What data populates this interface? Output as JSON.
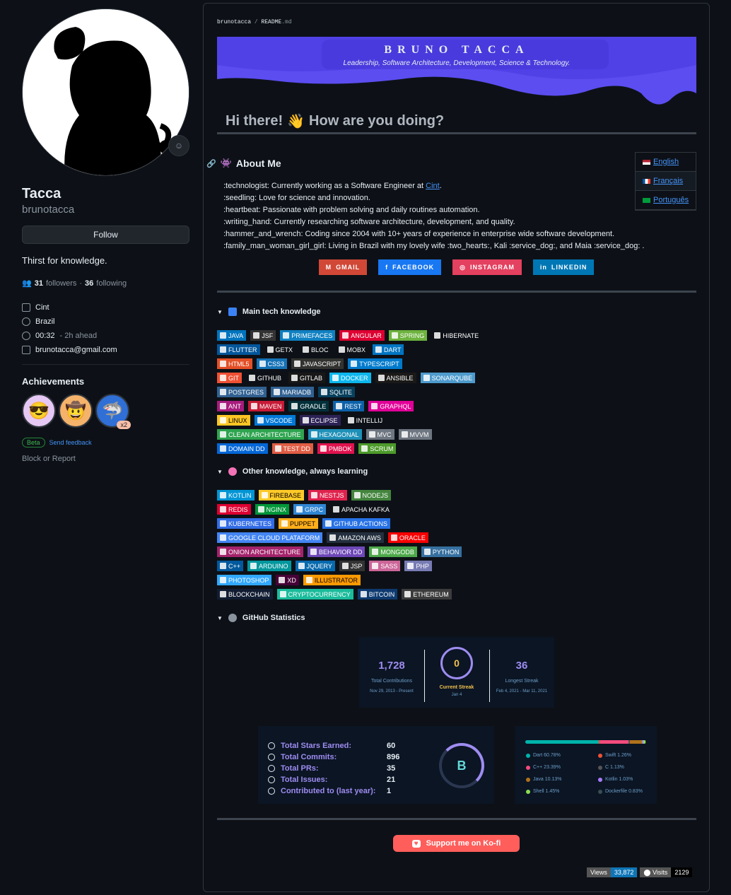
{
  "sidebar": {
    "name": "Tacca",
    "login": "brunotacca",
    "follow_label": "Follow",
    "bio": "Thirst for knowledge.",
    "followers_count": "31",
    "followers_label": "followers",
    "following_count": "36",
    "following_label": "following",
    "info": [
      {
        "icon": "building-icon",
        "text": "Cint"
      },
      {
        "icon": "location-icon",
        "text": "Brazil"
      },
      {
        "icon": "clock-icon",
        "text": "00:32",
        "muted": "- 2h ahead"
      },
      {
        "icon": "mail-icon",
        "text": "brunotacca@gmail.com"
      }
    ],
    "achievements_title": "Achievements",
    "achievement_multiplier": "x2",
    "beta_label": "Beta",
    "send_feedback": "Send feedback",
    "block_report": "Block or Report"
  },
  "readme": {
    "breadcrumb_user": "brunotacca",
    "breadcrumb_sep": " / ",
    "breadcrumb_file": "README",
    "breadcrumb_ext": ".md",
    "banner_title": "BRUNO  TACCA",
    "banner_subtitle": "Leadership, Software Architecture, Development, Science & Technology.",
    "hi_text": "Hi there!",
    "hi_text2": "How are you doing?",
    "languages": [
      "English",
      "Français",
      "Português"
    ],
    "about_title": "About Me",
    "about_lines": [
      ":technologist:  Currently working as a Software Engineer at ",
      ":seedling:  Love for science and innovation.",
      ":heartbeat:  Passionate with problem solving and daily routines automation.",
      ":writing_hand:  Currently researching software architecture, development, and quality.",
      ":hammer_and_wrench:  Coding since 2004 with 10+ years of experience in enterprise wide software development.",
      ":family_man_woman_girl_girl:  Living in Brazil with my lovely wife :two_hearts:, Kali :service_dog:, and Maia :service_dog: ."
    ],
    "about_link": "Cint",
    "about_link_end": ".",
    "social": [
      {
        "label": "GMAIL",
        "color": "#d14836"
      },
      {
        "label": "FACEBOOK",
        "color": "#1877f2"
      },
      {
        "label": "INSTAGRAM",
        "color": "#e4405f"
      },
      {
        "label": "LINKEDIN",
        "color": "#0077b5"
      }
    ],
    "main_tech_title": "Main tech knowledge",
    "other_title": "Other knowledge, always learning",
    "stats_title": "GitHub Statistics",
    "support": "Support me on Ko-fi",
    "views_label": "Views",
    "views_value": "33,872",
    "visits_label": "Visits",
    "visits_value": "2129"
  },
  "main_badges": [
    [
      [
        "JAVA",
        "#0074bd"
      ],
      [
        "JSF",
        "#333"
      ],
      [
        "PRIMEFACES",
        "#0f80c1"
      ],
      [
        "ANGULAR",
        "#dd0031"
      ],
      [
        "SPRING",
        "#6db33f"
      ],
      [
        "HIBERNATE",
        "#0d1117"
      ]
    ],
    [
      [
        "FLUTTER",
        "#02569b"
      ],
      [
        "GETX",
        "#0d1117"
      ],
      [
        "BLOC",
        "#0d1117"
      ],
      [
        "MOBX",
        "#0d1117"
      ],
      [
        "DART",
        "#0175c2"
      ]
    ],
    [
      [
        "HTML5",
        "#e34f26"
      ],
      [
        "CSS3",
        "#1572b6"
      ],
      [
        "JAVASCRIPT",
        "#323330"
      ],
      [
        "TYPESCRIPT",
        "#007acc"
      ]
    ],
    [
      [
        "GIT",
        "#f05033"
      ],
      [
        "GITHUB",
        "#0d1117"
      ],
      [
        "GITLAB",
        "#181717"
      ],
      [
        "DOCKER",
        "#0db7ed"
      ],
      [
        "ANSIBLE",
        "#1a1918"
      ],
      [
        "SONARQUBE",
        "#4e9bcd"
      ]
    ],
    [
      [
        "POSTGRES",
        "#316192"
      ],
      [
        "MARIADB",
        "#316192"
      ],
      [
        "SQLITE",
        "#07405e"
      ]
    ],
    [
      [
        "ANT",
        "#a81c7d"
      ],
      [
        "MAVEN",
        "#c71a36"
      ],
      [
        "GRADLE",
        "#02303a"
      ],
      [
        "REST",
        "#0d61a9"
      ],
      [
        "GRAPHQL",
        "#e10098"
      ]
    ],
    [
      [
        "LINUX",
        "#fcc624"
      ],
      [
        "VSCODE",
        "#0078d7"
      ],
      [
        "ECLIPSE",
        "#2c2255"
      ],
      [
        "INTELLIJ",
        "#0d1117"
      ]
    ],
    [
      [
        "CLEAN ARCHITECTURE",
        "#2ea44f"
      ],
      [
        "HEXAGONAL",
        "#1e90b8"
      ],
      [
        "MVC",
        "#6e7681"
      ],
      [
        "MVVM",
        "#6e7681"
      ]
    ],
    [
      [
        "DOMAIN DD",
        "#0366d6"
      ],
      [
        "TEST DD",
        "#e05d44"
      ],
      [
        "PMBOK",
        "#e0124e"
      ],
      [
        "SCRUM",
        "#4c9a2a"
      ]
    ]
  ],
  "other_badges": [
    [
      [
        "KOTLIN",
        "#0095d5"
      ],
      [
        "FIREBASE",
        "#ffca28"
      ],
      [
        "NESTJS",
        "#e0234e"
      ],
      [
        "NODEJS",
        "#43853d"
      ]
    ],
    [
      [
        "REDIS",
        "#dd0031"
      ],
      [
        "NGINX",
        "#009639"
      ],
      [
        "GRPC",
        "#2f86d3"
      ],
      [
        "APACHA KAFKA",
        "#0d1117"
      ]
    ],
    [
      [
        "KUBERNETES",
        "#326ce5"
      ],
      [
        "PUPPET",
        "#ffae1a"
      ],
      [
        "GITHUB ACTIONS",
        "#2671e5"
      ]
    ],
    [
      [
        "GOOGLE CLOUD PLATAFORM",
        "#4285f4"
      ],
      [
        "AMAZON AWS",
        "#232f3e"
      ],
      [
        "ORACLE",
        "#f80000"
      ]
    ],
    [
      [
        "ONION ARCHITECTURE",
        "#a3236b"
      ],
      [
        "BEHAVIOR DD",
        "#6e48b8"
      ],
      [
        "MONGODB",
        "#4ea94b"
      ],
      [
        "PYTHON",
        "#3670a0"
      ]
    ],
    [
      [
        "C++",
        "#00599c"
      ],
      [
        "ARDUINO",
        "#00979d"
      ],
      [
        "JQUERY",
        "#0769ad"
      ],
      [
        "JSP",
        "#333"
      ],
      [
        "SASS",
        "#cc6699"
      ],
      [
        "PHP",
        "#777bb4"
      ]
    ],
    [
      [
        "PHOTOSHOP",
        "#31a8ff"
      ],
      [
        "XD",
        "#470137"
      ],
      [
        "ILLUSTRATOR",
        "#ff9a00"
      ]
    ],
    [
      [
        "BLOCKCHAIN",
        "#121d33"
      ],
      [
        "CRYPTOCURRENCY",
        "#1abc9c"
      ],
      [
        "BITCOIN",
        "#0e3a70"
      ],
      [
        "ETHEREUM",
        "#3c3c3d"
      ]
    ]
  ],
  "streak": {
    "total": "1,728",
    "total_label": "Total Contributions",
    "total_range": "Nov 29, 2013 - Present",
    "current": "0",
    "current_label": "Current Streak",
    "current_range": "Jan 4",
    "longest": "36",
    "longest_label": "Longest Streak",
    "longest_range": "Feb 4, 2021 - Mar 11, 2021"
  },
  "stats": [
    {
      "label": "Total Stars Earned:",
      "value": "60"
    },
    {
      "label": "Total Commits:",
      "value": "896"
    },
    {
      "label": "Total PRs:",
      "value": "35"
    },
    {
      "label": "Total Issues:",
      "value": "21"
    },
    {
      "label": "Contributed to (last year):",
      "value": "1"
    }
  ],
  "grade": "B",
  "top_langs": [
    {
      "name": "Dart 60.78%",
      "pct": 60.78,
      "color": "#00b4ab"
    },
    {
      "name": "Swift 1.26%",
      "pct": 1.26,
      "color": "#f05138"
    },
    {
      "name": "C++ 23.39%",
      "pct": 23.39,
      "color": "#f34b7d"
    },
    {
      "name": "C 1.13%",
      "pct": 1.13,
      "color": "#555555"
    },
    {
      "name": "Java 10.13%",
      "pct": 10.13,
      "color": "#b07219"
    },
    {
      "name": "Kotlin 1.03%",
      "pct": 1.03,
      "color": "#a97bff"
    },
    {
      "name": "Shell 1.45%",
      "pct": 1.45,
      "color": "#89e051"
    },
    {
      "name": "Dockerfile 0.83%",
      "pct": 0.83,
      "color": "#384d54"
    }
  ]
}
